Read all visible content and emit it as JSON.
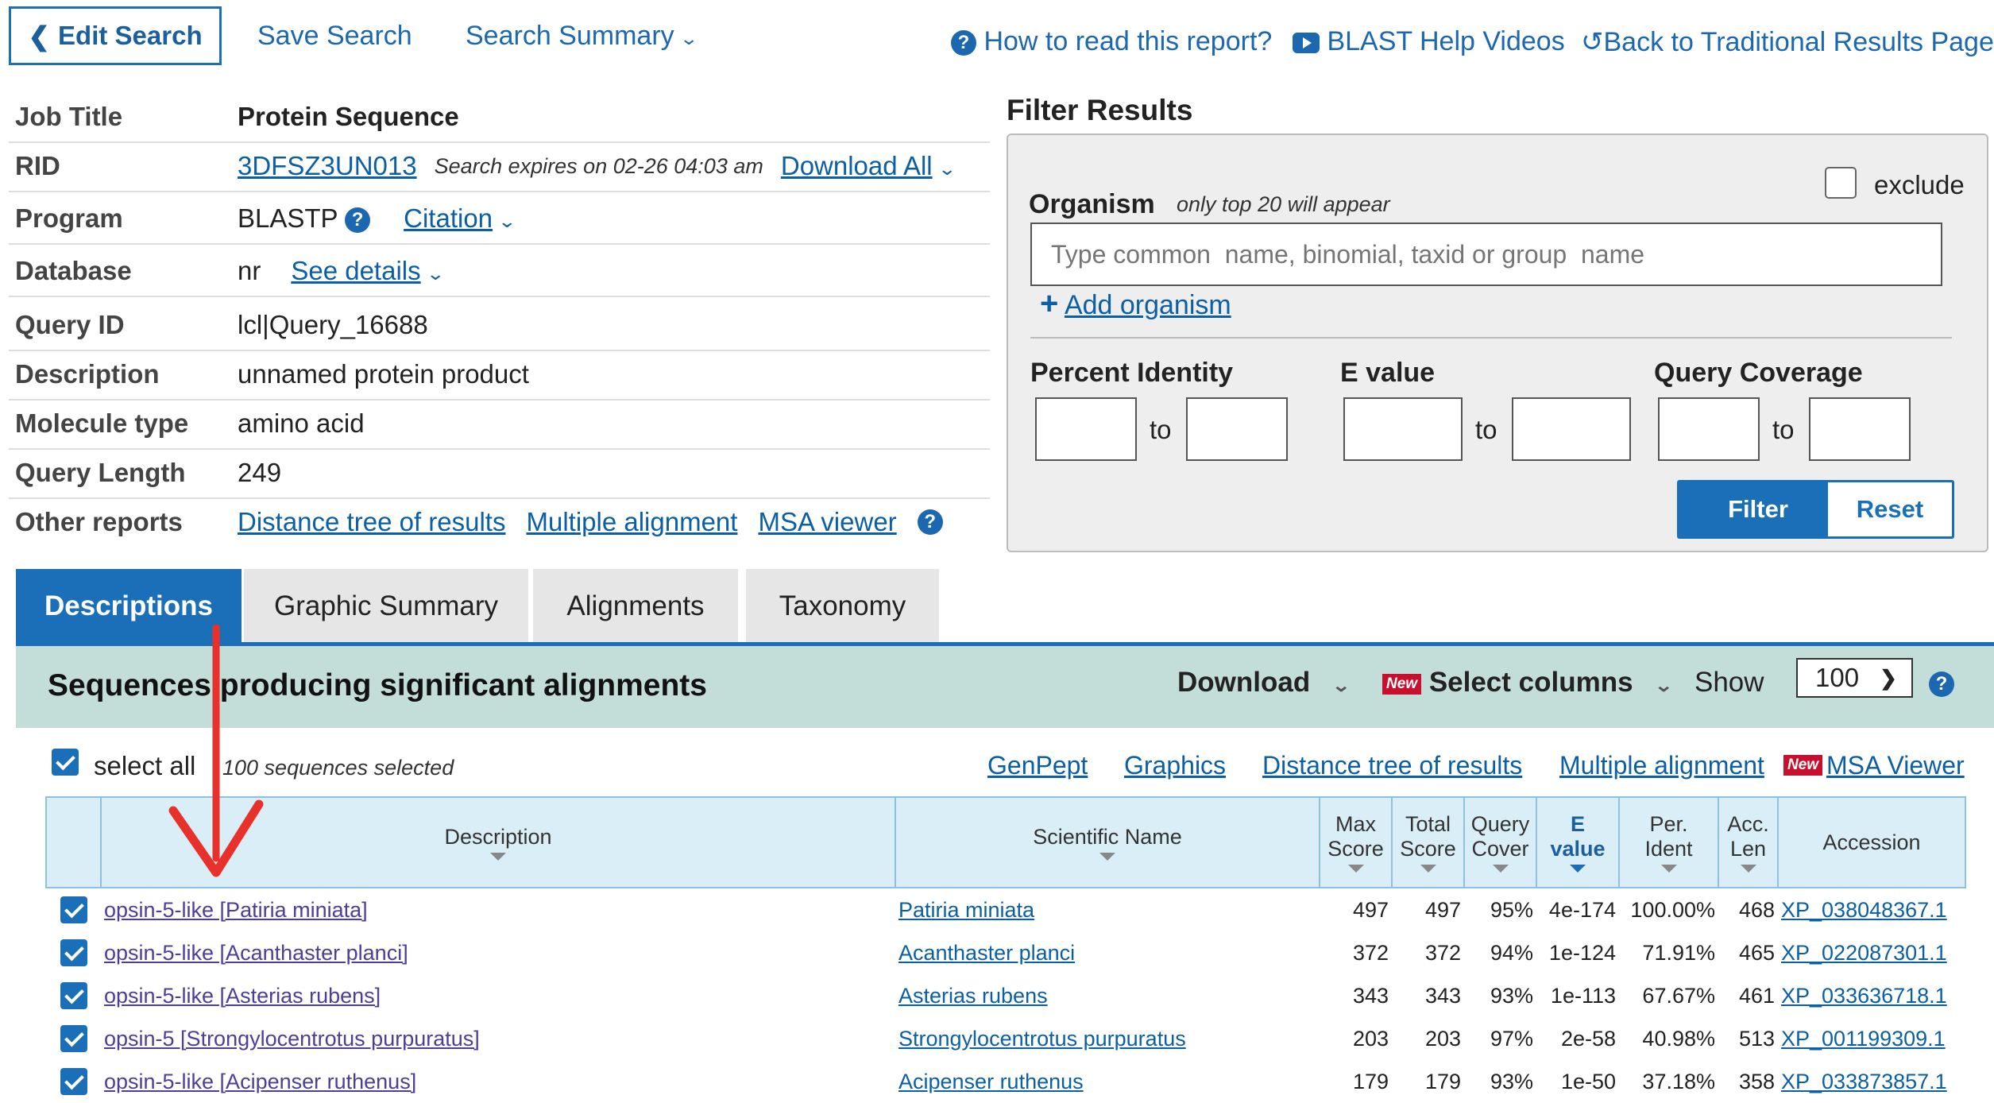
{
  "top_nav": {
    "edit_search": "Edit Search",
    "save_search": "Save Search",
    "search_summary": "Search Summary",
    "how_to_read": "How to read this report?",
    "help_videos": "BLAST Help Videos",
    "back_traditional": "Back to Traditional Results Page"
  },
  "job": {
    "job_title_label": "Job Title",
    "job_title": "Protein Sequence",
    "rid_label": "RID",
    "rid": "3DFSZ3UN013",
    "expires": "Search expires on 02-26 04:03 am",
    "download_all": "Download All",
    "program_label": "Program",
    "program": "BLASTP",
    "citation": "Citation",
    "database_label": "Database",
    "database": "nr",
    "see_details": "See details",
    "query_id_label": "Query ID",
    "query_id": "lcl|Query_16688",
    "description_label": "Description",
    "description": "unnamed protein product",
    "molecule_type_label": "Molecule type",
    "molecule_type": "amino acid",
    "query_length_label": "Query Length",
    "query_length": "249",
    "other_reports_label": "Other reports",
    "other_reports": [
      "Distance tree of results",
      "Multiple alignment",
      "MSA viewer"
    ]
  },
  "filter": {
    "title": "Filter Results",
    "organism_label": "Organism",
    "organism_note": "only top 20 will appear",
    "exclude_label": "exclude",
    "organism_placeholder": "Type common  name, binomial, taxid or group  name",
    "add_organism": "Add organism",
    "percent_identity": "Percent Identity",
    "e_value": "E value",
    "query_coverage": "Query Coverage",
    "to": "to",
    "filter_btn": "Filter",
    "reset_btn": "Reset"
  },
  "tabs": [
    "Descriptions",
    "Graphic Summary",
    "Alignments",
    "Taxonomy"
  ],
  "results": {
    "title": "Sequences producing significant alignments",
    "download": "Download",
    "new_badge": "New",
    "select_columns": "Select columns",
    "show_label": "Show",
    "show_value": "100",
    "select_all": "select all",
    "selected_note": "100 sequences selected",
    "toolbar_links": [
      "GenPept",
      "Graphics",
      "Distance tree of results",
      "Multiple alignment",
      "MSA Viewer"
    ],
    "columns": {
      "description": "Description",
      "scientific_name": "Scientific Name",
      "max_score": [
        "Max",
        "Score"
      ],
      "total_score": [
        "Total",
        "Score"
      ],
      "query_cover": [
        "Query",
        "Cover"
      ],
      "e_value": [
        "E",
        "value"
      ],
      "per_ident": [
        "Per.",
        "Ident"
      ],
      "acc_len": [
        "Acc.",
        "Len"
      ],
      "accession": "Accession"
    },
    "rows": [
      {
        "description": "opsin-5-like [Patiria miniata]",
        "scientific_name": "Patiria miniata",
        "max_score": "497",
        "total_score": "497",
        "query_cover": "95%",
        "e_value": "4e-174",
        "per_ident": "100.00%",
        "acc_len": "468",
        "accession": "XP_038048367.1"
      },
      {
        "description": "opsin-5-like [Acanthaster planci]",
        "scientific_name": "Acanthaster planci",
        "max_score": "372",
        "total_score": "372",
        "query_cover": "94%",
        "e_value": "1e-124",
        "per_ident": "71.91%",
        "acc_len": "465",
        "accession": "XP_022087301.1"
      },
      {
        "description": "opsin-5-like [Asterias rubens]",
        "scientific_name": "Asterias rubens",
        "max_score": "343",
        "total_score": "343",
        "query_cover": "93%",
        "e_value": "1e-113",
        "per_ident": "67.67%",
        "acc_len": "461",
        "accession": "XP_033636718.1"
      },
      {
        "description": "opsin-5 [Strongylocentrotus purpuratus]",
        "scientific_name": "Strongylocentrotus purpuratus",
        "max_score": "203",
        "total_score": "203",
        "query_cover": "97%",
        "e_value": "2e-58",
        "per_ident": "40.98%",
        "acc_len": "513",
        "accession": "XP_001199309.1"
      },
      {
        "description": "opsin-5-like [Acipenser ruthenus]",
        "scientific_name": "Acipenser ruthenus",
        "max_score": "179",
        "total_score": "179",
        "query_cover": "93%",
        "e_value": "1e-50",
        "per_ident": "37.18%",
        "acc_len": "358",
        "accession": "XP_033873857.1"
      }
    ]
  },
  "annotation": {
    "arrow_color": "#e8312a"
  }
}
